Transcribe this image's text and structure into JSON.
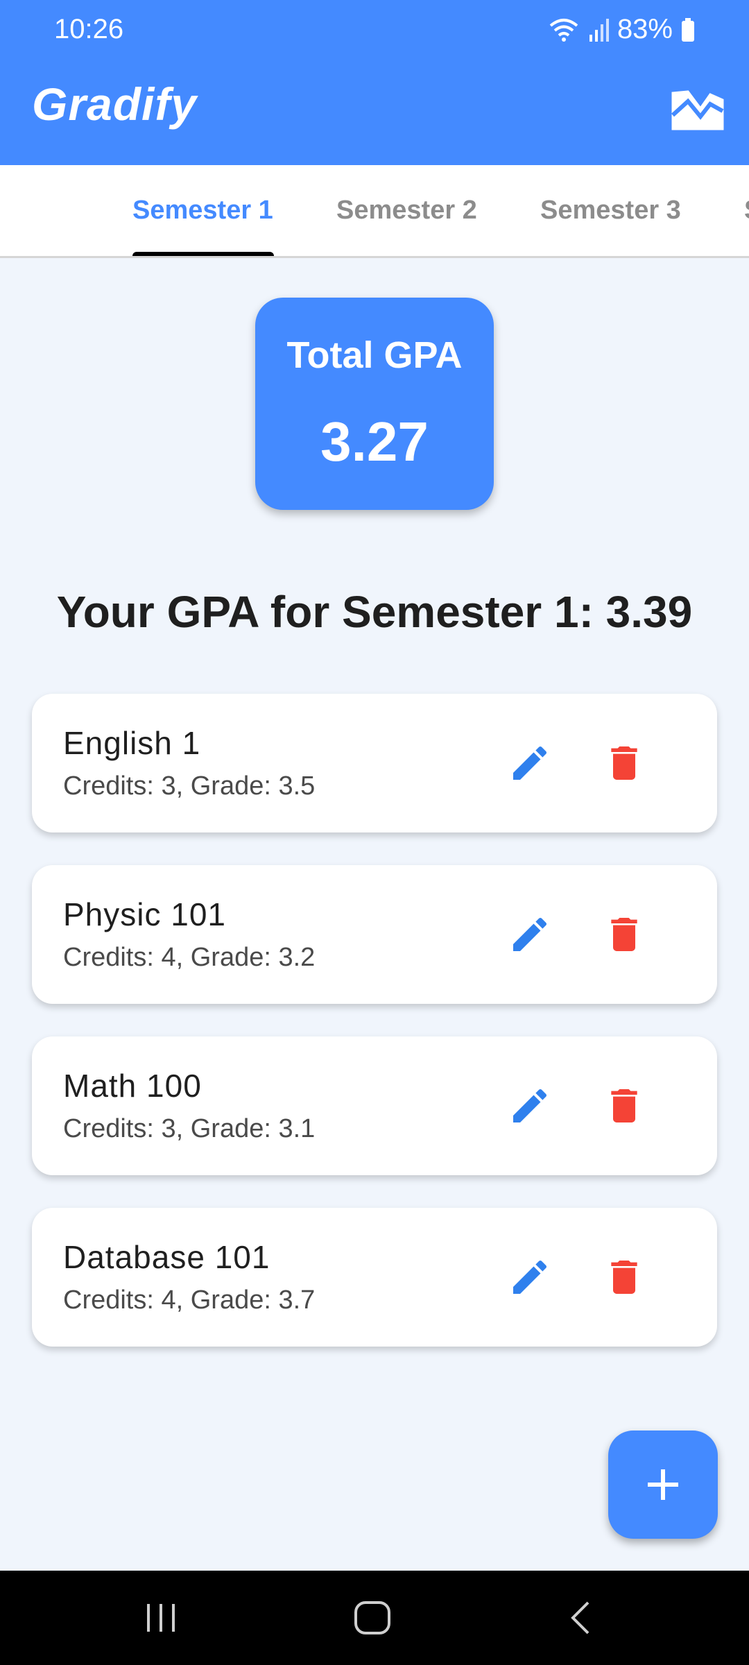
{
  "status_bar": {
    "time": "10:26",
    "battery": "83%",
    "icons": [
      "wifi-icon",
      "signal-icon",
      "battery-icon"
    ]
  },
  "app_bar": {
    "title": "Gradify",
    "chart_icon": "chart-icon"
  },
  "tabs": [
    {
      "label": "Semester 1",
      "active": true
    },
    {
      "label": "Semester 2",
      "active": false
    },
    {
      "label": "Semester 3",
      "active": false
    },
    {
      "label": "S",
      "active": false
    }
  ],
  "total_gpa": {
    "label": "Total GPA",
    "value": "3.27"
  },
  "semester_gpa_text": "Your GPA for Semester 1: 3.39",
  "courses": [
    {
      "name": "English 1",
      "meta": "Credits: 3, Grade: 3.5"
    },
    {
      "name": "Physic 101",
      "meta": "Credits: 4, Grade: 3.2"
    },
    {
      "name": "Math 100",
      "meta": "Credits: 3, Grade: 3.1"
    },
    {
      "name": "Database 101",
      "meta": "Credits: 4, Grade: 3.7"
    }
  ],
  "colors": {
    "primary": "#448aff",
    "edit": "#2f80ed",
    "delete": "#f44336",
    "background": "#f0f5fc"
  },
  "fab_icon": "plus-icon",
  "nav_icons": [
    "recents-icon",
    "home-icon",
    "back-icon"
  ]
}
